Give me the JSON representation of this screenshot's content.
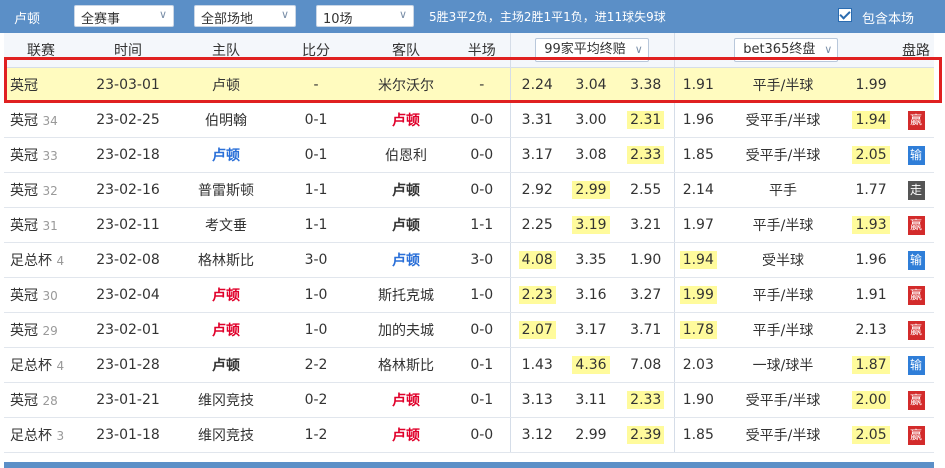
{
  "toolbar": {
    "team": "卢顿",
    "competition_filter": "全赛事",
    "venue_filter": "全部场地",
    "count_filter": "10场",
    "summary": "5胜3平2负，主场2胜1平1负，进11球失9球",
    "include_label": "包含本场"
  },
  "headers": {
    "league": "联赛",
    "time": "时间",
    "home": "主队",
    "score": "比分",
    "away": "客队",
    "half": "半场",
    "odds_select": "99家平均终赔",
    "bet_select": "bet365终盘",
    "result": "盘路"
  },
  "rows": [
    {
      "league": "英冠",
      "num": "",
      "date": "23-03-01",
      "home": "卢顿",
      "home_style": "plain",
      "score": "-",
      "away": "米尔沃尔",
      "away_style": "plain",
      "half": "-",
      "o1": "2.24",
      "o2": "3.04",
      "o3": "3.38",
      "hl": "",
      "b1": "1.91",
      "line": "平手/半球",
      "b2": "1.99",
      "b2hl": false,
      "res": "",
      "res_type": ""
    },
    {
      "league": "英冠",
      "num": "34",
      "date": "23-02-25",
      "home": "伯明翰",
      "home_style": "plain",
      "score": "0-1",
      "away": "卢顿",
      "away_style": "red",
      "half": "0-0",
      "o1": "3.31",
      "o2": "3.00",
      "o3": "2.31",
      "hl": "o3",
      "b1": "1.96",
      "line": "受平手/半球",
      "b2": "1.94",
      "b2hl": true,
      "res": "赢",
      "res_type": "win"
    },
    {
      "league": "英冠",
      "num": "33",
      "date": "23-02-18",
      "home": "卢顿",
      "home_style": "blue",
      "score": "0-1",
      "away": "伯恩利",
      "away_style": "plain",
      "half": "0-0",
      "o1": "3.17",
      "o2": "3.08",
      "o3": "2.33",
      "hl": "o3",
      "b1": "1.85",
      "line": "受平手/半球",
      "b2": "2.05",
      "b2hl": true,
      "res": "输",
      "res_type": "lose"
    },
    {
      "league": "英冠",
      "num": "32",
      "date": "23-02-16",
      "home": "普雷斯顿",
      "home_style": "plain",
      "score": "1-1",
      "away": "卢顿",
      "away_style": "plain-bold",
      "half": "0-0",
      "o1": "2.92",
      "o2": "2.99",
      "o3": "2.55",
      "hl": "o2",
      "b1": "2.14",
      "line": "平手",
      "b2": "1.77",
      "b2hl": false,
      "res": "走",
      "res_type": "draw"
    },
    {
      "league": "英冠",
      "num": "31",
      "date": "23-02-11",
      "home": "考文垂",
      "home_style": "plain",
      "score": "1-1",
      "away": "卢顿",
      "away_style": "plain-bold",
      "half": "1-1",
      "o1": "2.25",
      "o2": "3.19",
      "o3": "3.21",
      "hl": "o2",
      "b1": "1.97",
      "line": "平手/半球",
      "b2": "1.93",
      "b2hl": true,
      "res": "赢",
      "res_type": "win"
    },
    {
      "league": "足总杯",
      "num": "4",
      "date": "23-02-08",
      "home": "格林斯比",
      "home_style": "plain",
      "score": "3-0",
      "away": "卢顿",
      "away_style": "blue",
      "half": "3-0",
      "o1": "4.08",
      "o2": "3.35",
      "o3": "1.90",
      "hl": "o1",
      "b1": "1.94",
      "b1hl": true,
      "line": "受半球",
      "b2": "1.96",
      "b2hl": false,
      "res": "输",
      "res_type": "lose"
    },
    {
      "league": "英冠",
      "num": "30",
      "date": "23-02-04",
      "home": "卢顿",
      "home_style": "red",
      "score": "1-0",
      "away": "斯托克城",
      "away_style": "plain",
      "half": "1-0",
      "o1": "2.23",
      "o2": "3.16",
      "o3": "3.27",
      "hl": "o1",
      "b1": "1.99",
      "b1hl": true,
      "line": "平手/半球",
      "b2": "1.91",
      "b2hl": false,
      "res": "赢",
      "res_type": "win"
    },
    {
      "league": "英冠",
      "num": "29",
      "date": "23-02-01",
      "home": "卢顿",
      "home_style": "red",
      "score": "1-0",
      "away": "加的夫城",
      "away_style": "plain",
      "half": "0-0",
      "o1": "2.07",
      "o2": "3.17",
      "o3": "3.71",
      "hl": "o1",
      "b1": "1.78",
      "b1hl": true,
      "line": "平手/半球",
      "b2": "2.13",
      "b2hl": false,
      "res": "赢",
      "res_type": "win"
    },
    {
      "league": "足总杯",
      "num": "4",
      "date": "23-01-28",
      "home": "卢顿",
      "home_style": "plain-bold",
      "score": "2-2",
      "away": "格林斯比",
      "away_style": "plain",
      "half": "0-1",
      "o1": "1.43",
      "o2": "4.36",
      "o3": "7.08",
      "hl": "o2",
      "b1": "2.03",
      "line": "一球/球半",
      "b2": "1.87",
      "b2hl": true,
      "res": "输",
      "res_type": "lose"
    },
    {
      "league": "英冠",
      "num": "28",
      "date": "23-01-21",
      "home": "维冈竞技",
      "home_style": "plain",
      "score": "0-2",
      "away": "卢顿",
      "away_style": "red",
      "half": "0-1",
      "o1": "3.13",
      "o2": "3.11",
      "o3": "2.33",
      "hl": "o3",
      "b1": "1.90",
      "line": "受平手/半球",
      "b2": "2.00",
      "b2hl": true,
      "res": "赢",
      "res_type": "win"
    },
    {
      "league": "足总杯",
      "num": "3",
      "date": "23-01-18",
      "home": "维冈竞技",
      "home_style": "plain",
      "score": "1-2",
      "away": "卢顿",
      "away_style": "red",
      "half": "0-0",
      "o1": "3.12",
      "o2": "2.99",
      "o3": "2.39",
      "hl": "o3",
      "b1": "1.85",
      "line": "受平手/半球",
      "b2": "2.05",
      "b2hl": true,
      "res": "赢",
      "res_type": "win"
    }
  ]
}
